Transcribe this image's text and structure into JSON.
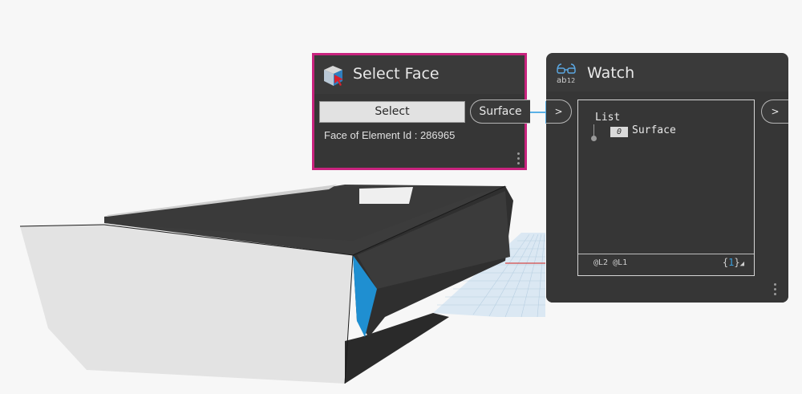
{
  "select_face_node": {
    "title": "Select Face",
    "select_label": "Select",
    "info": "Face of Element Id : 286965",
    "output_port": "Surface"
  },
  "watch_node": {
    "title": "Watch",
    "input_port": ">",
    "output_port": ">",
    "tree_root": "List",
    "item_index": "0",
    "item_value": "Surface",
    "levels": "@L2 @L1",
    "count_open": "{",
    "count_value": "1",
    "count_close": "}"
  },
  "colors": {
    "selection_border": "#c8237e",
    "node_bg": "#3a3a3a",
    "selected_face": "#1f8fd1",
    "connector": "#5ab1e6"
  },
  "icons": {
    "select_face": "cube-cursor-icon",
    "watch": "glasses-ab12-icon"
  }
}
